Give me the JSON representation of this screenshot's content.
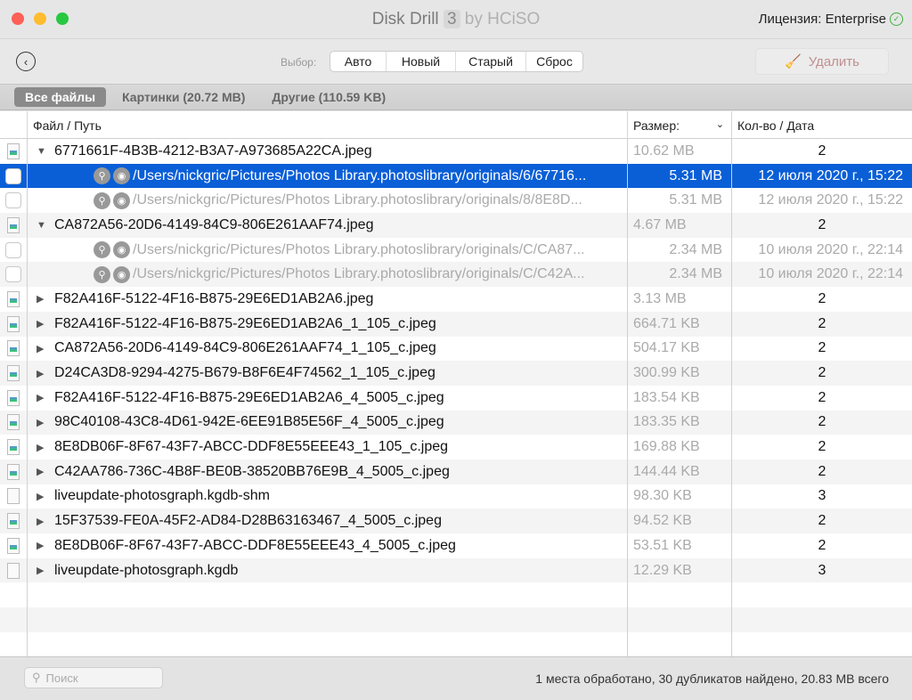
{
  "window": {
    "title": "Disk Drill",
    "version": "3",
    "by": "by HCiSO",
    "license": "Лицензия: Enterprise"
  },
  "toolbar": {
    "select_label": "Выбор:",
    "segments": [
      "Авто",
      "Новый",
      "Старый",
      "Сброс"
    ],
    "delete_label": "Удалить"
  },
  "tabs": [
    "Все файлы",
    "Картинки (20.72 MB)",
    "Другие (110.59 KB)"
  ],
  "columns": {
    "file": "Файл / Путь",
    "size": "Размер:",
    "count": "Кол-во / Дата"
  },
  "rows": [
    {
      "type": "group",
      "expanded": true,
      "icon": "image",
      "name": "6771661F-4B3B-4212-B3A7-A973685A22CA.jpeg",
      "size": "10.62 MB",
      "count": "2"
    },
    {
      "type": "child",
      "selected": true,
      "name": "/Users/nickgric/Pictures/Photos Library.photoslibrary/originals/6/67716...",
      "size": "5.31 MB",
      "count": "12 июля 2020 г., 15:22"
    },
    {
      "type": "child",
      "name": "/Users/nickgric/Pictures/Photos Library.photoslibrary/originals/8/8E8D...",
      "size": "5.31 MB",
      "count": "12 июля 2020 г., 15:22"
    },
    {
      "type": "group",
      "expanded": true,
      "icon": "image",
      "name": "CA872A56-20D6-4149-84C9-806E261AAF74.jpeg",
      "size": "4.67 MB",
      "count": "2"
    },
    {
      "type": "child",
      "name": "/Users/nickgric/Pictures/Photos Library.photoslibrary/originals/C/CA87...",
      "size": "2.34 MB",
      "count": "10 июля 2020 г., 22:14"
    },
    {
      "type": "child",
      "name": "/Users/nickgric/Pictures/Photos Library.photoslibrary/originals/C/C42A...",
      "size": "2.34 MB",
      "count": "10 июля 2020 г., 22:14"
    },
    {
      "type": "group",
      "icon": "image",
      "name": "F82A416F-5122-4F16-B875-29E6ED1AB2A6.jpeg",
      "size": "3.13 MB",
      "count": "2"
    },
    {
      "type": "group",
      "icon": "image",
      "name": "F82A416F-5122-4F16-B875-29E6ED1AB2A6_1_105_c.jpeg",
      "size": "664.71 KB",
      "count": "2"
    },
    {
      "type": "group",
      "icon": "image",
      "name": "CA872A56-20D6-4149-84C9-806E261AAF74_1_105_c.jpeg",
      "size": "504.17 KB",
      "count": "2"
    },
    {
      "type": "group",
      "icon": "image",
      "name": "D24CA3D8-9294-4275-B679-B8F6E4F74562_1_105_c.jpeg",
      "size": "300.99 KB",
      "count": "2"
    },
    {
      "type": "group",
      "icon": "image",
      "name": "F82A416F-5122-4F16-B875-29E6ED1AB2A6_4_5005_c.jpeg",
      "size": "183.54 KB",
      "count": "2"
    },
    {
      "type": "group",
      "icon": "image",
      "name": "98C40108-43C8-4D61-942E-6EE91B85E56F_4_5005_c.jpeg",
      "size": "183.35 KB",
      "count": "2"
    },
    {
      "type": "group",
      "icon": "image",
      "name": "8E8DB06F-8F67-43F7-ABCC-DDF8E55EEE43_1_105_c.jpeg",
      "size": "169.88 KB",
      "count": "2"
    },
    {
      "type": "group",
      "icon": "image",
      "name": "C42AA786-736C-4B8F-BE0B-38520BB76E9B_4_5005_c.jpeg",
      "size": "144.44 KB",
      "count": "2"
    },
    {
      "type": "group",
      "icon": "doc",
      "name": "liveupdate-photosgraph.kgdb-shm",
      "size": "98.30 KB",
      "count": "3"
    },
    {
      "type": "group",
      "icon": "image",
      "name": "15F37539-FE0A-45F2-AD84-D28B63163467_4_5005_c.jpeg",
      "size": "94.52 KB",
      "count": "2"
    },
    {
      "type": "group",
      "icon": "image",
      "name": "8E8DB06F-8F67-43F7-ABCC-DDF8E55EEE43_4_5005_c.jpeg",
      "size": "53.51 KB",
      "count": "2"
    },
    {
      "type": "group",
      "icon": "doc",
      "name": "liveupdate-photosgraph.kgdb",
      "size": "12.29 KB",
      "count": "3"
    }
  ],
  "footer": {
    "search_placeholder": "Поиск",
    "status": "1 места обработано, 30 дубликатов найдено, 20.83 MB всего"
  },
  "colors": {
    "selection": "#0a5fd7",
    "license_ok": "#3cb03c"
  }
}
